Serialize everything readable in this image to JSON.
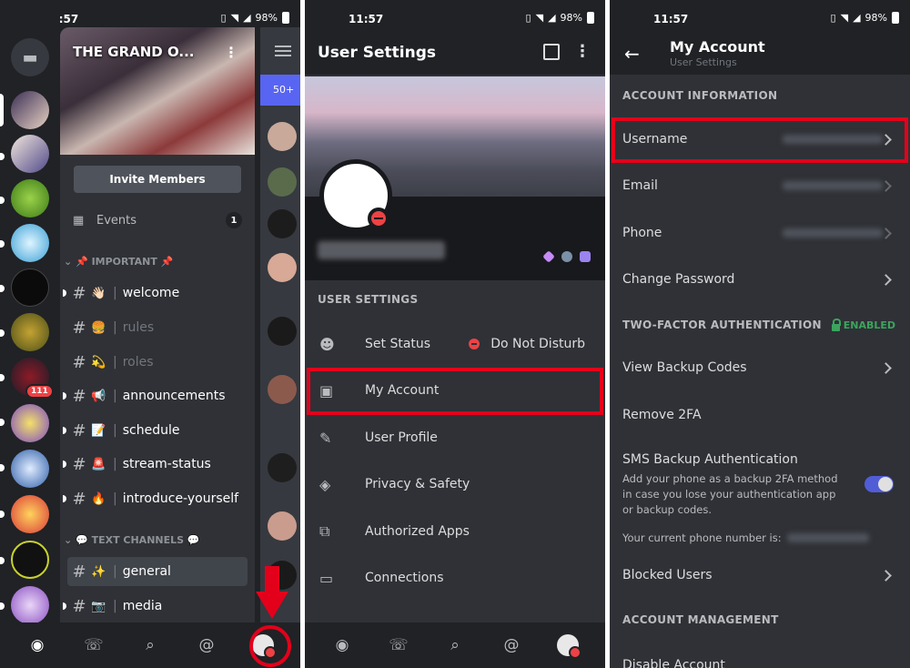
{
  "status": {
    "time": "11:57",
    "battery": "98%"
  },
  "panel1": {
    "server_name": "THE GRAND O...",
    "invite_label": "Invite Members",
    "events_label": "Events",
    "events_count": "1",
    "category_important": "📌 IMPORTANT 📌",
    "category_text": "💬 TEXT CHANNELS 💬",
    "server_badge": "111",
    "member_pill": "50+",
    "channels": [
      {
        "emoji": "👋🏻",
        "name": "welcome"
      },
      {
        "emoji": "🍔",
        "name": "rules"
      },
      {
        "emoji": "💫",
        "name": "roles"
      },
      {
        "emoji": "📢",
        "name": "announcements"
      },
      {
        "emoji": "📝",
        "name": "schedule"
      },
      {
        "emoji": "🚨",
        "name": "stream-status"
      },
      {
        "emoji": "🔥",
        "name": "introduce-yourself"
      },
      {
        "emoji": "✨",
        "name": "general"
      },
      {
        "emoji": "📷",
        "name": "media"
      }
    ]
  },
  "panel2": {
    "title": "User Settings",
    "section_label": "USER SETTINGS",
    "items": [
      {
        "icon": "status-icon",
        "label": "Set Status",
        "value": "Do Not Disturb"
      },
      {
        "icon": "account-icon",
        "label": "My Account"
      },
      {
        "icon": "pencil-icon",
        "label": "User Profile"
      },
      {
        "icon": "shield-icon",
        "label": "Privacy & Safety"
      },
      {
        "icon": "apps-icon",
        "label": "Authorized Apps"
      },
      {
        "icon": "devices-icon",
        "label": "Connections"
      }
    ]
  },
  "panel3": {
    "title": "My Account",
    "subtitle": "User Settings",
    "section_account": "ACCOUNT INFORMATION",
    "section_2fa": "TWO-FACTOR AUTHENTICATION",
    "enabled_label": "ENABLED",
    "section_mgmt": "ACCOUNT MANAGEMENT",
    "rows": {
      "username": "Username",
      "email": "Email",
      "phone": "Phone",
      "change_password": "Change Password",
      "backup_codes": "View Backup Codes",
      "remove_2fa": "Remove 2FA",
      "blocked": "Blocked Users",
      "disable": "Disable Account"
    },
    "sms_title": "SMS Backup Authentication",
    "sms_desc": "Add your phone as a backup 2FA method in case you lose your authentication app or backup codes.",
    "phone_line": "Your current phone number is:"
  },
  "colors": {
    "accent": "#5865f2",
    "highlight": "#e3001b",
    "dnd": "#ed4245",
    "enabled": "#3ba55d"
  }
}
